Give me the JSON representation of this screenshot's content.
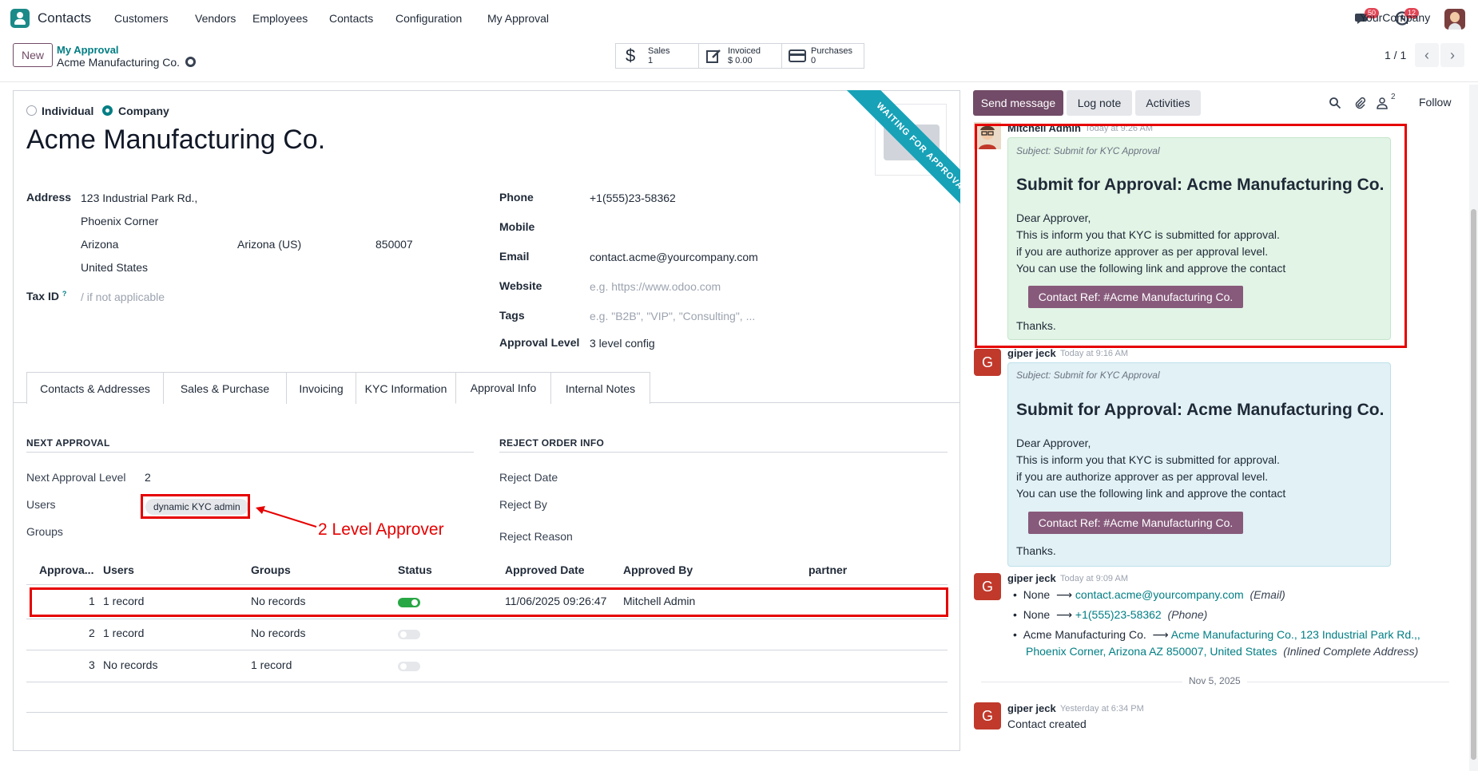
{
  "topbar": {
    "app_name": "Contacts",
    "menus": [
      "Customers",
      "Vendors",
      "Employees",
      "Contacts",
      "Configuration",
      "My Approval"
    ],
    "messages_badge": "50",
    "activities_badge": "12",
    "company": "YourCompany"
  },
  "control": {
    "new_label": "New",
    "breadcrumb_parent": "My Approval",
    "breadcrumb_current": "Acme Manufacturing Co.",
    "stats": [
      {
        "label": "Sales",
        "value": "1",
        "icon": "dollar-icon"
      },
      {
        "label": "Invoiced",
        "value": "$ 0.00",
        "icon": "invoice-icon"
      },
      {
        "label": "Purchases",
        "value": "0",
        "icon": "credit-card-icon"
      }
    ],
    "pager": "1 / 1"
  },
  "form": {
    "type_individual": "Individual",
    "type_company": "Company",
    "selected_type": "Company",
    "name": "Acme Manufacturing Co.",
    "ribbon": "WAITING FOR APPROVAL",
    "address_label": "Address",
    "street": "123 Industrial Park Rd.,",
    "street2": "Phoenix Corner",
    "city": "Arizona",
    "state": "Arizona (US)",
    "zip": "850007",
    "country": "United States",
    "taxid_label": "Tax ID",
    "taxid_help": "?",
    "taxid_placeholder": "/ if not applicable",
    "phone_label": "Phone",
    "phone": "+1(555)23-58362",
    "mobile_label": "Mobile",
    "email_label": "Email",
    "email": "contact.acme@yourcompany.com",
    "website_label": "Website",
    "website_placeholder": "e.g. https://www.odoo.com",
    "tags_label": "Tags",
    "tags_placeholder": "e.g. \"B2B\", \"VIP\", \"Consulting\", ...",
    "approval_level_label": "Approval Level",
    "approval_level": "3 level config"
  },
  "tabs": [
    "Contacts & Addresses",
    "Sales & Purchase",
    "Invoicing",
    "KYC Information",
    "Approval Info",
    "Internal Notes"
  ],
  "active_tab": "Approval Info",
  "approval": {
    "next_title": "NEXT APPROVAL",
    "next_level_label": "Next Approval Level",
    "next_level": "2",
    "users_label": "Users",
    "user_tag": "dynamic KYC admin",
    "groups_label": "Groups",
    "annotation": "2 Level Approver",
    "reject_title": "REJECT ORDER INFO",
    "reject_date_label": "Reject Date",
    "reject_by_label": "Reject By",
    "reject_reason_label": "Reject Reason",
    "columns": [
      "Approva...",
      "Users",
      "Groups",
      "Status",
      "Approved Date",
      "Approved By",
      "partner"
    ],
    "rows": [
      {
        "level": "1",
        "users": "1 record",
        "groups": "No records",
        "status_on": true,
        "date": "11/06/2025 09:26:47",
        "by": "Mitchell Admin"
      },
      {
        "level": "2",
        "users": "1 record",
        "groups": "No records",
        "status_on": false,
        "date": "",
        "by": ""
      },
      {
        "level": "3",
        "users": "No records",
        "groups": "1 record",
        "status_on": false,
        "date": "",
        "by": ""
      }
    ]
  },
  "chatter": {
    "send_message": "Send message",
    "log_note": "Log note",
    "activities": "Activities",
    "followers_count": "2",
    "follow": "Follow",
    "messages": [
      {
        "author": "Mitchell Admin",
        "time": "Today at 9:26 AM",
        "subject": "Subject: Submit for KYC Approval",
        "heading": "Submit for Approval: Acme Manufacturing Co.",
        "lines": [
          "Dear Approver,",
          "This is inform you that KYC is submitted for approval.",
          "if you are authorize approver as per approval level.",
          "You can use the following link and approve the contact"
        ],
        "button": "Contact Ref: #Acme Manufacturing Co.",
        "thanks": "Thanks."
      },
      {
        "author": "giper jeck",
        "initial": "G",
        "time": "Today at 9:16 AM",
        "subject": "Subject: Submit for KYC Approval",
        "heading": "Submit for Approval: Acme Manufacturing Co.",
        "lines": [
          "Dear Approver,",
          "This is inform you that KYC is submitted for approval.",
          "if you are authorize approver as per approval level.",
          "You can use the following link and approve the contact"
        ],
        "button": "Contact Ref: #Acme Manufacturing Co.",
        "thanks": "Thanks."
      }
    ],
    "tracking": {
      "author": "giper jeck",
      "initial": "G",
      "time": "Today at 9:09 AM",
      "changes": [
        {
          "old": "None",
          "new": "contact.acme@yourcompany.com",
          "field": "(Email)"
        },
        {
          "old": "None",
          "new": "+1(555)23-58362",
          "field": "(Phone)"
        },
        {
          "old": "Acme Manufacturing Co.",
          "new": "Acme Manufacturing Co., 123 Industrial Park Rd.,,",
          "new2": "Phoenix Corner, Arizona AZ 850007, United States",
          "field": "(Inlined Complete Address)"
        }
      ]
    },
    "date_separator": "Nov 5, 2025",
    "created": {
      "author": "giper jeck",
      "initial": "G",
      "time": "Yesterday at 6:34 PM",
      "text": "Contact created"
    }
  },
  "colors": {
    "brand": "#714b67",
    "teal": "#017e84",
    "ribbon": "#17a2b8",
    "highlight": "#e60000"
  }
}
